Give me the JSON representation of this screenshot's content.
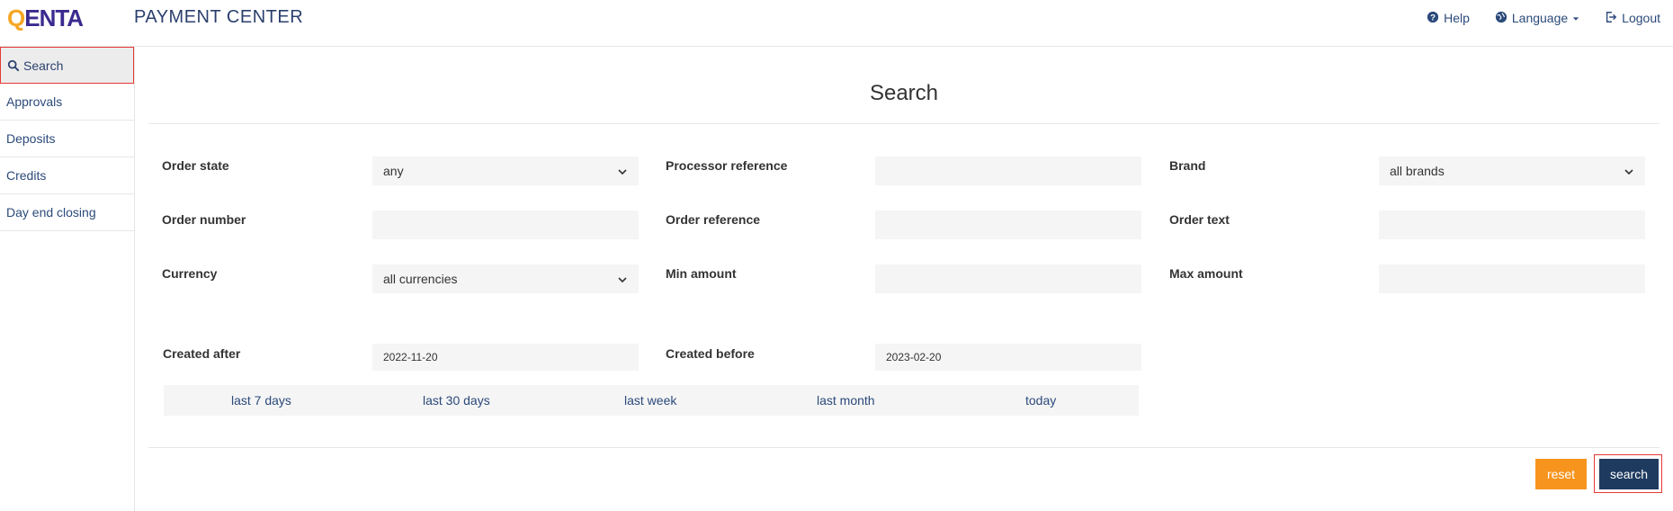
{
  "header": {
    "logo_q": "Q",
    "logo_rest": "ENTA",
    "app_title": "PAYMENT CENTER",
    "nav": [
      {
        "label": "Help",
        "icon": "question-circle-icon"
      },
      {
        "label": "Language",
        "icon": "globe-icon"
      },
      {
        "label": "Logout",
        "icon": "sign-out-icon"
      }
    ]
  },
  "sidebar": {
    "items": [
      {
        "label": "Search",
        "icon": "search-icon",
        "active": true
      },
      {
        "label": "Approvals"
      },
      {
        "label": "Deposits"
      },
      {
        "label": "Credits"
      },
      {
        "label": "Day end closing"
      }
    ]
  },
  "main": {
    "title": "Search",
    "fields": {
      "order_state": {
        "label": "Order state",
        "value": "any"
      },
      "processor_reference": {
        "label": "Processor reference",
        "value": ""
      },
      "brand": {
        "label": "Brand",
        "value": "all brands"
      },
      "order_number": {
        "label": "Order number",
        "value": ""
      },
      "order_reference": {
        "label": "Order reference",
        "value": ""
      },
      "order_text": {
        "label": "Order text",
        "value": ""
      },
      "currency": {
        "label": "Currency",
        "value": "all currencies"
      },
      "min_amount": {
        "label": "Min amount",
        "value": ""
      },
      "max_amount": {
        "label": "Max amount",
        "value": ""
      },
      "created_after": {
        "label": "Created after",
        "value": "2022-11-20"
      },
      "created_before": {
        "label": "Created before",
        "value": "2023-02-20"
      }
    },
    "quick_ranges": [
      "last 7 days",
      "last 30 days",
      "last week",
      "last month",
      "today"
    ],
    "buttons": {
      "reset": "reset",
      "search": "search"
    }
  },
  "colors": {
    "brand_navy": "#1e3a5f",
    "accent_orange": "#f7941d",
    "link_blue": "#2b4a7a",
    "highlight_red": "#e53935"
  }
}
